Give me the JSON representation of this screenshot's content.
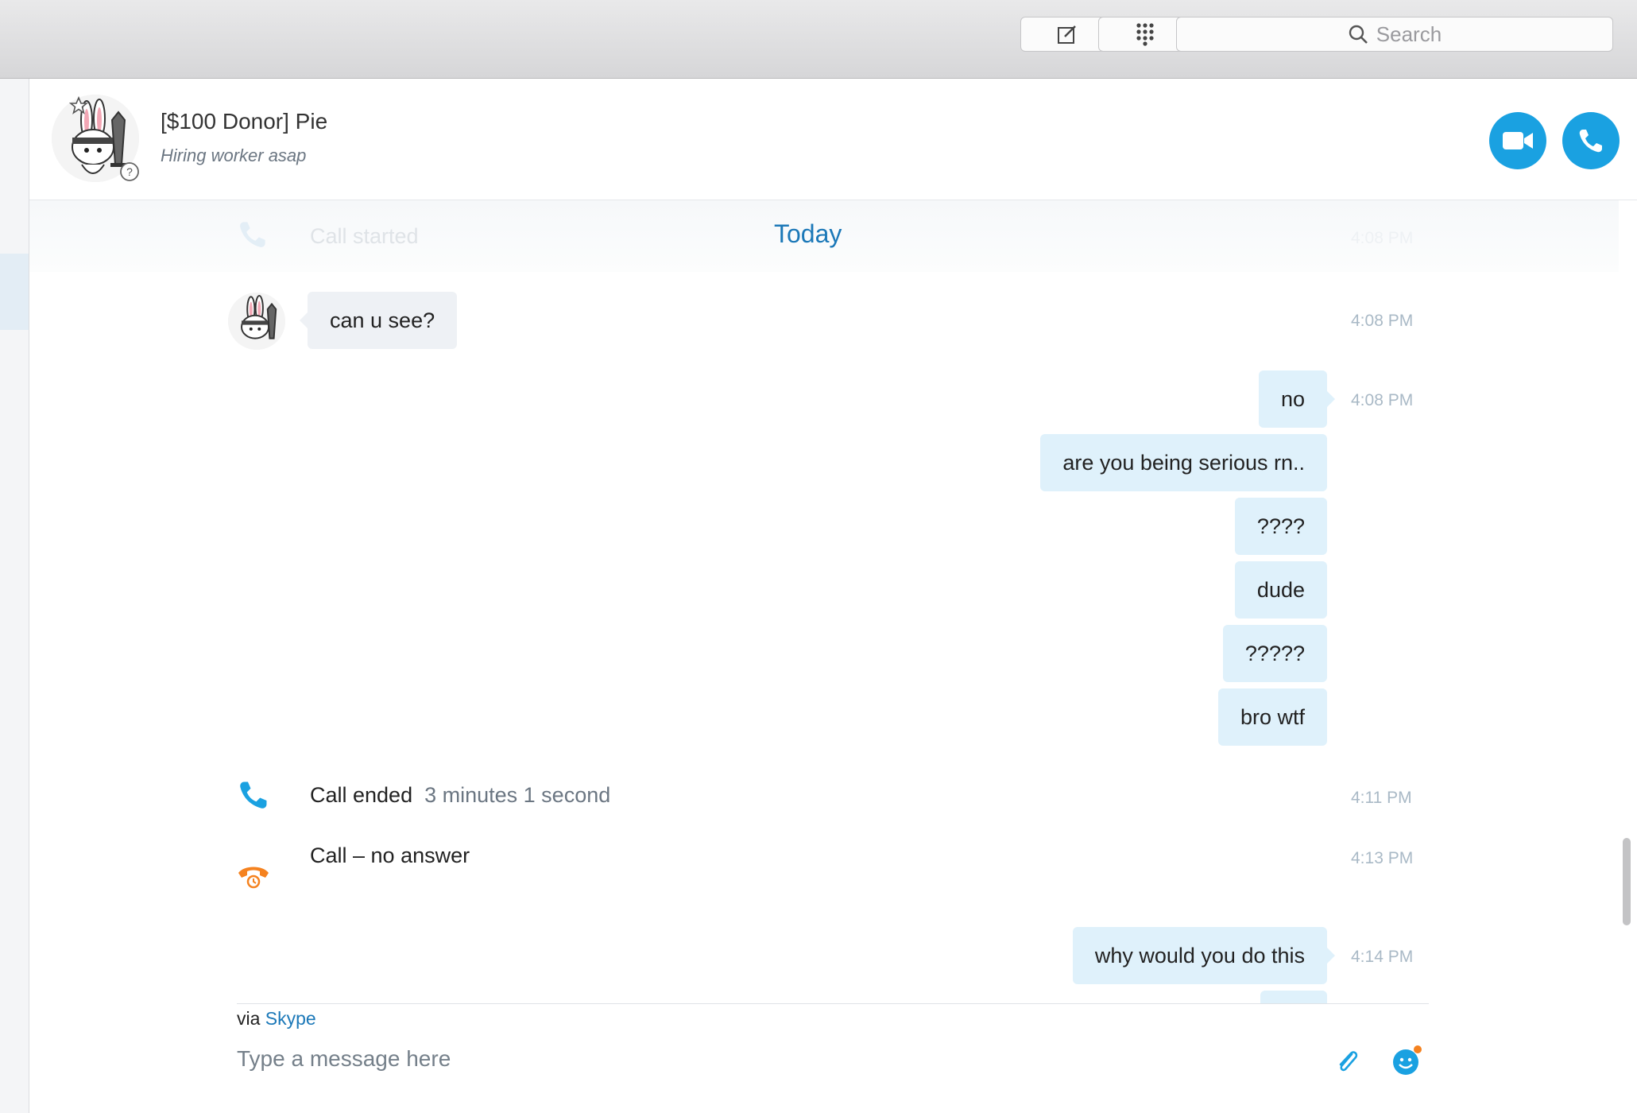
{
  "toolbar": {
    "compose_icon": "compose-icon",
    "dialpad_icon": "dialpad-icon",
    "search_placeholder": "Search"
  },
  "conversation": {
    "contact_name": "[$100 Donor] Pie",
    "mood_message": "Hiring worker asap"
  },
  "chat": {
    "faded_event": {
      "text": "Call started",
      "time": "4:08 PM"
    },
    "date_divider": "Today",
    "messages": [
      {
        "dir": "in",
        "text": "can u see?",
        "time": "4:08 PM"
      },
      {
        "dir": "out",
        "text": "no",
        "time": "4:08 PM"
      },
      {
        "dir": "out",
        "text": "are you being serious rn.."
      },
      {
        "dir": "out",
        "text": "????"
      },
      {
        "dir": "out",
        "text": "dude"
      },
      {
        "dir": "out",
        "text": "?????"
      },
      {
        "dir": "out",
        "text": "bro wtf"
      }
    ],
    "call_ended": {
      "label": "Call ended",
      "duration": "3 minutes 1 second",
      "time": "4:11 PM"
    },
    "call_missed": {
      "label": "Call – no answer",
      "time": "4:13 PM"
    },
    "last_message": {
      "dir": "out",
      "text": "why would you do this",
      "time": "4:14 PM"
    }
  },
  "composer": {
    "via_prefix": "via",
    "via_link": "Skype",
    "placeholder": "Type a message here"
  },
  "colors": {
    "accent": "#1aa1e1",
    "link": "#1b78b8",
    "outgoing_bubble": "#dff1fb",
    "incoming_bubble": "#eef1f5",
    "missed_call": "#f5821f"
  }
}
